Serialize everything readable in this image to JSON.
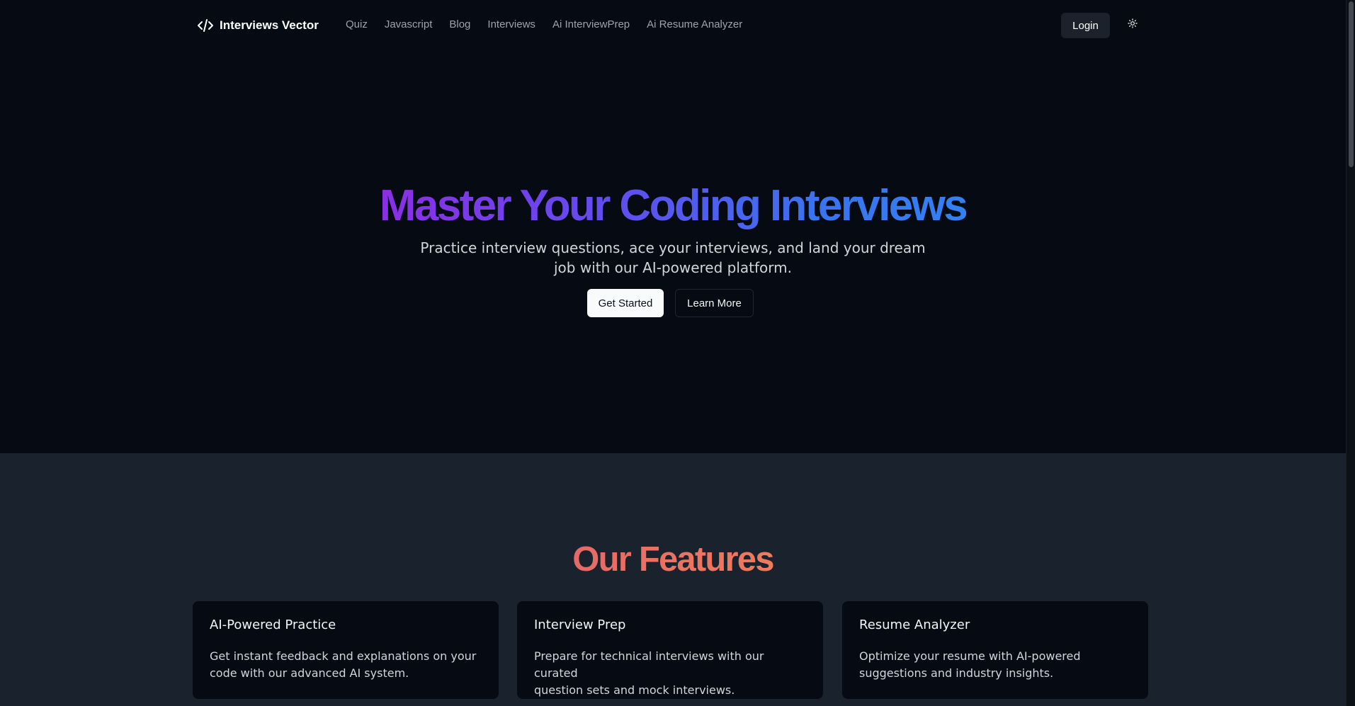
{
  "header": {
    "brand": "Interviews Vector",
    "brand_icon": "code-icon",
    "nav": [
      "Quiz",
      "Javascript",
      "Blog",
      "Interviews",
      "Ai InterviewPrep",
      "Ai Resume Analyzer"
    ],
    "login_label": "Login",
    "theme_icon": "sun-icon"
  },
  "hero": {
    "title": "Master Your Coding Interviews",
    "subtitle_line1": "Practice interview questions, ace your interviews, and land your dream",
    "subtitle_line2": "job with our AI-powered platform.",
    "primary_cta": "Get Started",
    "secondary_cta": "Learn More"
  },
  "features": {
    "title": "Our Features",
    "cards": [
      {
        "title": "AI-Powered Practice",
        "line1": "Get instant feedback and explanations on your",
        "line2": "code with our advanced AI system."
      },
      {
        "title": "Interview Prep",
        "line1": "Prepare for technical interviews with our curated",
        "line2": "question sets and mock interviews."
      },
      {
        "title": "Resume Analyzer",
        "line1": "Optimize your resume with AI-powered",
        "line2": "suggestions and industry insights."
      }
    ]
  },
  "colors": {
    "background": "#050a13",
    "features_background": "#1a222d",
    "title_gradient_start": "#8b2ee6",
    "title_gradient_end": "#3281f2",
    "features_title": "#ec7262"
  }
}
